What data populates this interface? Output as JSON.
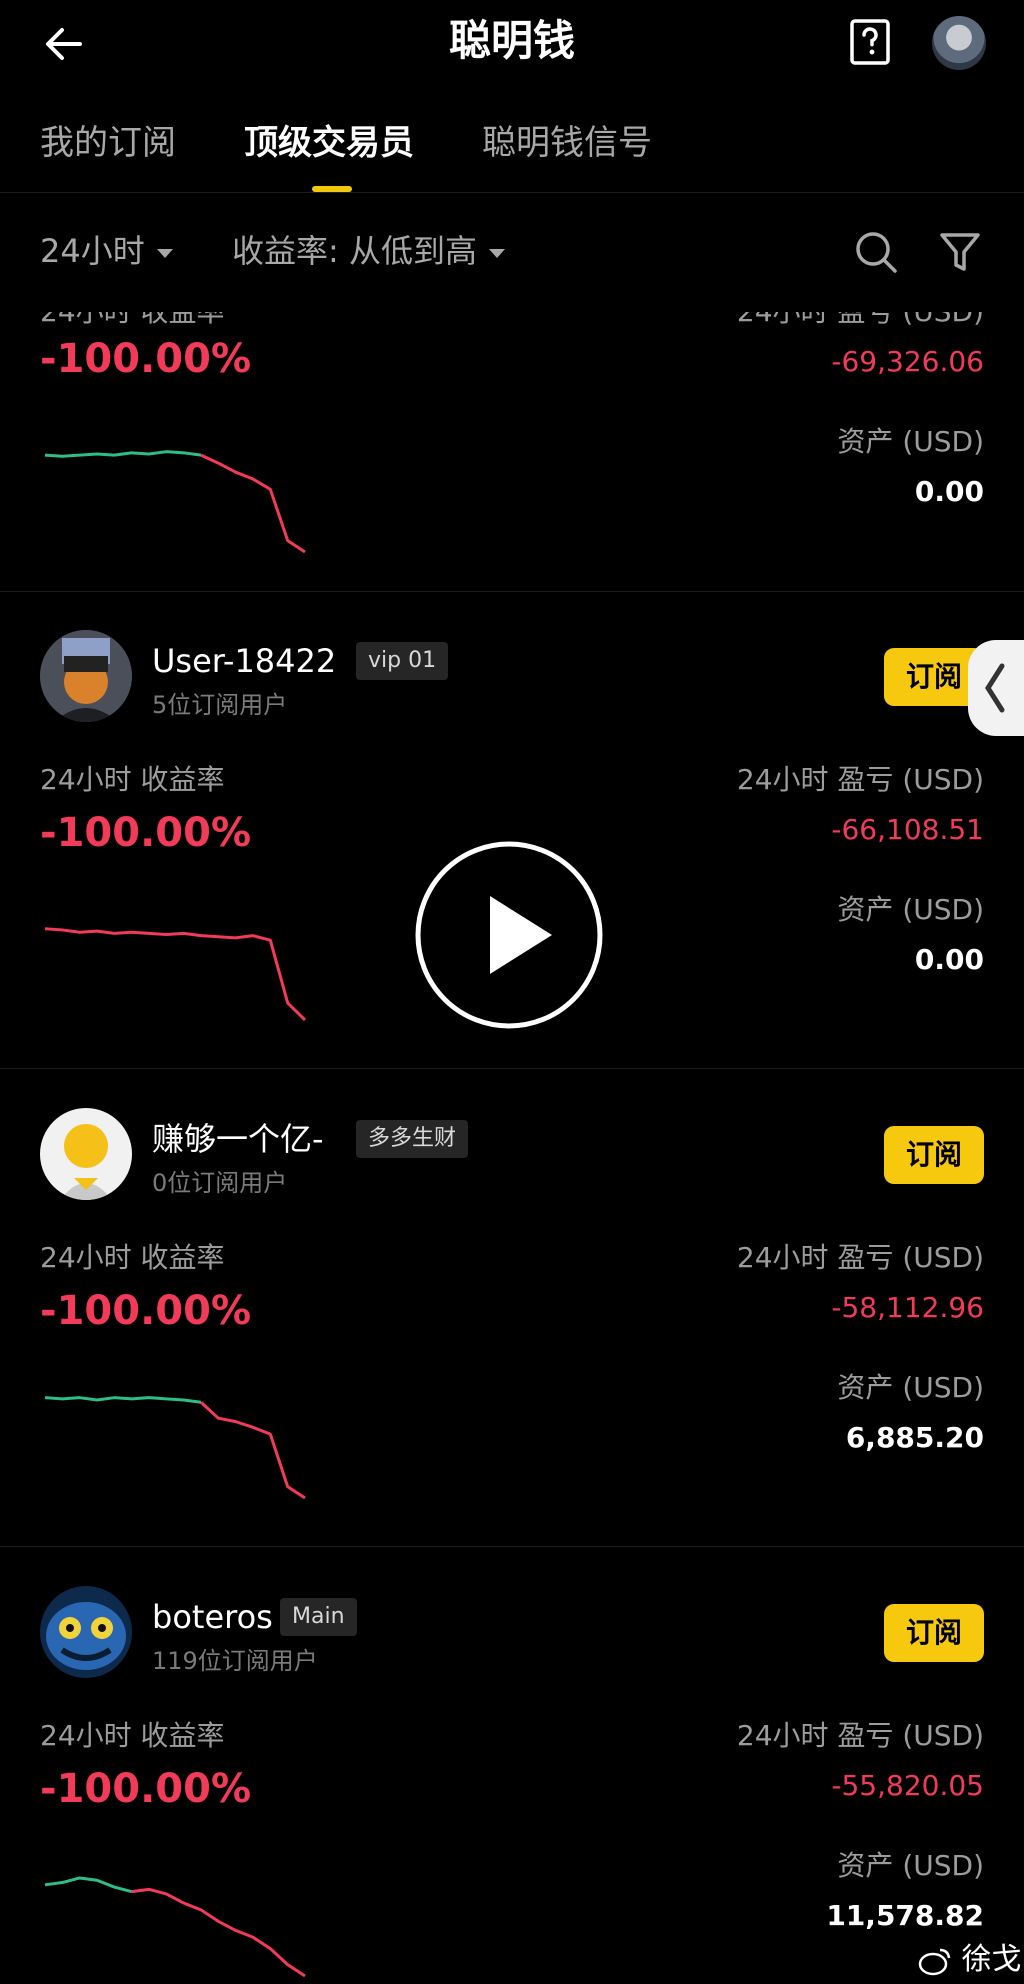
{
  "header": {
    "title": "聪明钱",
    "back_icon": "arrow-left-icon",
    "help_icon": "question-book-icon"
  },
  "tabs": [
    {
      "label": "我的订阅",
      "active": false
    },
    {
      "label": "顶级交易员",
      "active": true
    },
    {
      "label": "聪明钱信号",
      "active": false
    }
  ],
  "filters": {
    "period": "24小时",
    "sort": "收益率: 从低到高",
    "search_icon": "search-icon",
    "filter_icon": "funnel-icon"
  },
  "labels": {
    "roi": "24小时 收益率",
    "pnl": "24小时 盈亏 (USD)",
    "assets": "资产 (USD)",
    "subscribe": "订阅"
  },
  "traders": [
    {
      "name": "",
      "badge": "",
      "subscribers": "",
      "roi": "-100.00%",
      "pnl": "-69,326.06",
      "assets": "0.00",
      "spark": [
        0.15,
        0.16,
        0.15,
        0.14,
        0.15,
        0.13,
        0.14,
        0.12,
        0.13,
        0.15,
        0.22,
        0.3,
        0.36,
        0.45,
        0.9,
        1.0
      ],
      "spark_split": 9
    },
    {
      "name": "User-18422",
      "badge": "vip 01",
      "subscribers": "5位订阅用户",
      "roi": "-100.00%",
      "pnl": "-66,108.51",
      "assets": "0.00",
      "spark": [
        0.2,
        0.21,
        0.23,
        0.22,
        0.24,
        0.23,
        0.24,
        0.25,
        0.24,
        0.26,
        0.27,
        0.28,
        0.26,
        0.3,
        0.85,
        1.0
      ],
      "spark_split": 0
    },
    {
      "name": "赚够一个亿-",
      "badge": "多多生财",
      "subscribers": "0位订阅用户",
      "roi": "-100.00%",
      "pnl": "-58,112.96",
      "assets": "6,885.20",
      "spark": [
        0.12,
        0.13,
        0.12,
        0.14,
        0.12,
        0.13,
        0.12,
        0.13,
        0.14,
        0.16,
        0.3,
        0.33,
        0.38,
        0.44,
        0.9,
        1.0
      ],
      "spark_split": 9
    },
    {
      "name": "boteros",
      "badge": "Main",
      "subscribers": "119位订阅用户",
      "roi": "-100.00%",
      "pnl": "-55,820.05",
      "assets": "11,578.82",
      "spark": [
        0.2,
        0.18,
        0.14,
        0.16,
        0.22,
        0.26,
        0.24,
        0.28,
        0.36,
        0.42,
        0.52,
        0.6,
        0.66,
        0.76,
        0.9,
        1.0
      ],
      "spark_split": 5
    }
  ],
  "colors": {
    "accent": "#f6c90f",
    "loss": "#f23a59",
    "gain": "#2dbd85"
  },
  "overlay": {
    "play_icon": "play-icon",
    "side_handle_icon": "chevron-left-icon",
    "watermark": "徐戈",
    "watermark_icon": "weibo-icon"
  }
}
